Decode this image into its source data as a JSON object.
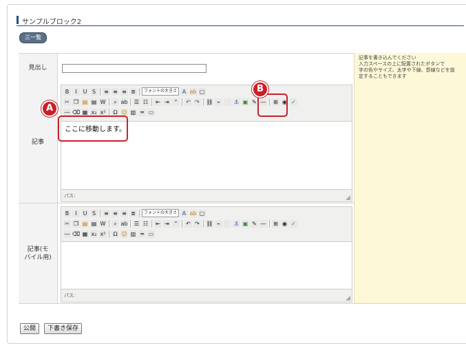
{
  "block": {
    "title": "サンプルブロック2",
    "list_button": "三一覧"
  },
  "rows": {
    "heading_label": "見出し",
    "article_label": "記事",
    "mobile_label_line1": "記事(モ",
    "mobile_label_line2": "バイル用)"
  },
  "hint": {
    "line1": "記事を書き込んでください",
    "line2": "入力スペースの上に配置されたボタンで",
    "line3": "字の色やサイズ、太字や下線、罫線などを設",
    "line4": "定することもできます"
  },
  "editor": {
    "font_size_select": "フォントの大きさ",
    "content_text": "ここに移動します。",
    "path_label": "パス:"
  },
  "annotations": {
    "a": "A",
    "b": "B"
  },
  "buttons": {
    "publish": "公開",
    "save_draft": "下書き保存"
  },
  "colors": {
    "annotation_red": "#c8202a",
    "title_blue": "#1f4e8c",
    "hint_bg": "#fdf8d8"
  }
}
